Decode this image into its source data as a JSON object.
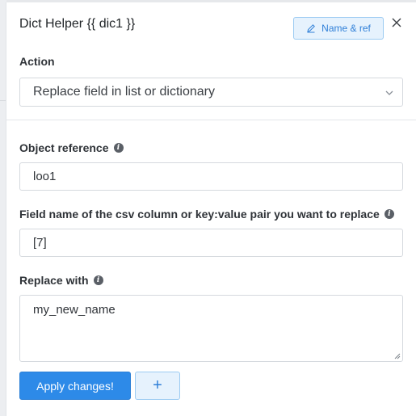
{
  "panel": {
    "title": "Dict Helper {{ dic1 }}",
    "name_ref_label": "Name & ref",
    "close_icon": "close-icon"
  },
  "action": {
    "label": "Action",
    "selected": "Replace field in list or dictionary"
  },
  "object_reference": {
    "label": "Object reference",
    "value": "loo1"
  },
  "field_name": {
    "label": "Field name of the csv column or key:value pair you want to replace",
    "value": "[7]"
  },
  "replace_with": {
    "label": "Replace with",
    "value": "my_new_name"
  },
  "buttons": {
    "apply_label": "Apply changes!",
    "add_label": "+"
  },
  "colors": {
    "primary": "#2d8ae8",
    "secondary_bg": "#e6f2fd",
    "secondary_text": "#2f7fd8"
  }
}
